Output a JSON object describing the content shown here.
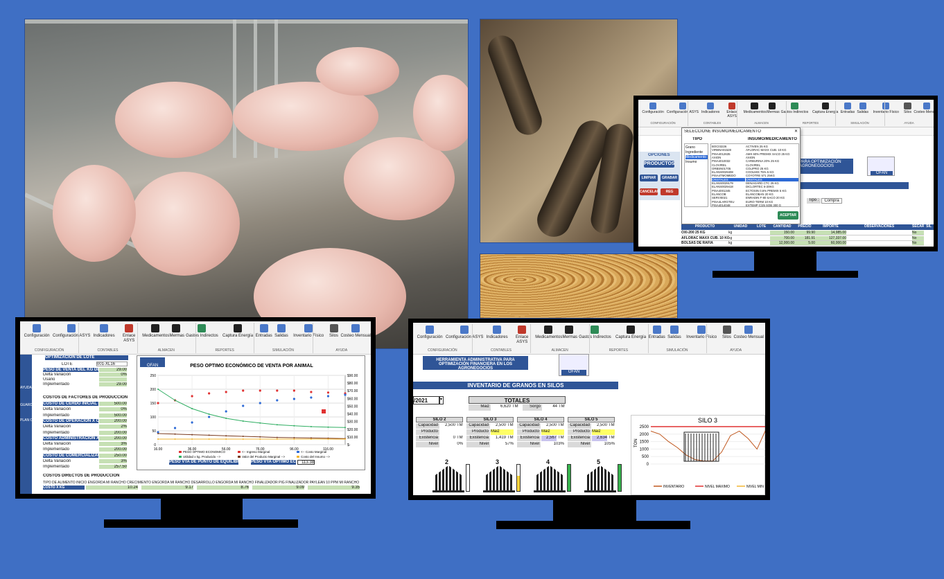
{
  "ribbon": {
    "items": [
      {
        "label": "Configuración",
        "icon": "config-icon",
        "color": "#4a78c8"
      },
      {
        "label": "Configuración ASYS",
        "icon": "config-asys-icon",
        "color": "#4a78c8"
      },
      {
        "label": "Indicadores",
        "icon": "indicadores-icon",
        "color": "#4a78c8"
      },
      {
        "label": "Enlace ASYS",
        "icon": "enlace-icon",
        "color": "#c0392b"
      },
      {
        "label": "Medicamentos",
        "icon": "medicamentos-icon",
        "color": "#222222"
      },
      {
        "label": "Mermas",
        "icon": "mermas-icon",
        "color": "#222222"
      },
      {
        "label": "Gastos Indirectos",
        "icon": "gastos-icon",
        "color": "#2e8b57"
      },
      {
        "label": "Captura Energía",
        "icon": "energia-icon",
        "color": "#222222"
      },
      {
        "label": "Entradas",
        "icon": "entradas-icon",
        "color": "#4a78c8"
      },
      {
        "label": "Salidas",
        "icon": "salidas-icon",
        "color": "#4a78c8"
      },
      {
        "label": "Inventario Físico",
        "icon": "inventario-icon",
        "color": "#4a78c8"
      },
      {
        "label": "Silos",
        "icon": "silos-icon",
        "color": "#555555"
      },
      {
        "label": "Costeo Mensual",
        "icon": "costeo-icon",
        "color": "#4a78c8"
      },
      {
        "label": "Diario",
        "icon": "diario-icon",
        "color": "#4a78c8"
      },
      {
        "label": "Semanal",
        "icon": "semanal-icon",
        "color": "#4a78c8"
      },
      {
        "label": "Mensual",
        "icon": "mensual-icon",
        "color": "#4a78c8"
      },
      {
        "label": "Mermas e Gráficas Inventario",
        "icon": "graficas-icon",
        "color": "#4a78c8"
      },
      {
        "label": "Entrar",
        "icon": "entrar-icon",
        "color": "#4a78c8"
      },
      {
        "label": "Resultados",
        "icon": "resultados-icon",
        "color": "#4a78c8"
      },
      {
        "label": "Acerda de",
        "icon": "acerca-icon",
        "color": "#c0392b"
      },
      {
        "label": "Versión",
        "icon": "version-icon",
        "color": "#4a78c8"
      }
    ],
    "groups": [
      "CONFIGURACIÓN",
      "CONTABLES",
      "ALMACEN",
      "REPORTES",
      "SIMULACIÓN",
      "AYUDA"
    ]
  },
  "monitor_left": {
    "lote_label": "LOTE",
    "lote_value": "001-XL16",
    "opt_title": "OPTIMIZACIÓN DE LOTE",
    "rows": [
      {
        "label": "PESO DE VENTA DEL KG DE CERDO",
        "value": "29.00"
      },
      {
        "label": "Delta Variación",
        "value": "0%"
      },
      {
        "label": "Usario",
        "value": ""
      },
      {
        "label": "Implementado",
        "value": "29.00"
      }
    ],
    "section_costs": "COSTOS DE FACTORES DE PRODUCCIÓN",
    "cost_rows": [
      {
        "label": "COSTO DE CERDO INICIAL ENGORDA",
        "value": "500.00"
      },
      {
        "label": "Delta Variación",
        "value": "0%"
      },
      {
        "label": "Implementado",
        "value": "500.00"
      },
      {
        "label": "COSTO DE OPERACIÓN X CERDO",
        "value": "200.00"
      },
      {
        "label": "Delta Variación",
        "value": "2%"
      },
      {
        "label": "Implementado",
        "value": "200.00"
      },
      {
        "label": "COSTO ADMINISTRACIÓN X CERDO",
        "value": "200.00"
      },
      {
        "label": "Delta Variación",
        "value": "3%"
      },
      {
        "label": "Implementado",
        "value": "200.00"
      },
      {
        "label": "COSTO DE COMERCIALIZACIÓN X CERDO",
        "value": "250.00"
      },
      {
        "label": "Delta Variación",
        "value": "3%"
      },
      {
        "label": "Implementado",
        "value": "257.50"
      }
    ],
    "section_direct": "COSTOS DIRECTOS DE PRODUCCIÓN",
    "feed_header": "TIPO DE ALIMENTO   INICIO ENGORDA MI RANCHO CRECIMIENTO ENGORDA MI RANCHO DESARROLLO ENGORDA MI RANCHO FINALIZADOR PIG FINALIZADOR PAYLEAN 10 PPM MI RANCHO",
    "feed_cost_label": "COSTO X KG",
    "feed_costs": [
      "10.24",
      "9.17",
      "8.76",
      "9.09",
      "9.35"
    ],
    "sidebar_labels": [
      "AYUDA",
      "GUARDAR LOTE",
      "PLAN OPTIMIZACIÓN"
    ],
    "ofan": "OFAN",
    "footer_left_label": "PESO VTA DE PUNTO DE EQUILIBRIO",
    "footer_right_label": "PESO VTA OPTIMO ECONOMICO",
    "footer_right_value": "113.38"
  },
  "chart_data": {
    "type": "scatter",
    "title": "PESO OPTIMO ECONÓMICO DE VENTA POR ANIMAL",
    "x": [
      16,
      26,
      36,
      46,
      56,
      66,
      76,
      86,
      96,
      106,
      116,
      126
    ],
    "xticks": [
      "16.00",
      "36.00",
      "56.00",
      "76.00",
      "96.00",
      "116.00"
    ],
    "ylim": [
      0,
      250
    ],
    "yticks": [
      "0",
      "50",
      "100",
      "150",
      "200",
      "250"
    ],
    "y2ticks": [
      "$-",
      "$10.00",
      "$20.00",
      "$30.00",
      "$40.00",
      "$50.00",
      "$60.00",
      "$70.00",
      "$80.00",
      "$90.00"
    ],
    "series": [
      {
        "name": "<-- Ingreso Marginal",
        "color": "#e03131",
        "values": [
          150,
          160,
          175,
          185,
          190,
          195,
          195,
          195,
          195,
          190,
          188,
          185
        ]
      },
      {
        "name": "<-- Costo Marginal",
        "color": "#2f6bd6",
        "values": [
          45,
          60,
          80,
          100,
          120,
          140,
          150,
          160,
          165,
          170,
          175,
          180
        ]
      },
      {
        "name": "Utilidad x kg. Producido -->",
        "color": "#2fae62",
        "values": [
          200,
          160,
          130,
          110,
          95,
          85,
          78,
          72,
          68,
          65,
          63,
          62
        ]
      },
      {
        "name": "Valor del Producto Marginal -->",
        "color": "#7a3b1f",
        "values": [
          40,
          38,
          36,
          34,
          32,
          30,
          28,
          26,
          25,
          24,
          23,
          22
        ]
      },
      {
        "name": "COSTO X KG PRODUCIDO -->",
        "color": "#f2b632",
        "values": [
          20,
          20,
          20,
          20,
          20,
          20,
          20,
          20,
          20,
          20,
          20,
          20
        ]
      }
    ],
    "legend_items": [
      "PESO OPTIMO ECONOMICO",
      "<-- Ingreso Marginal",
      "<-- Costo Marginal",
      "Utilidad x kg. Producido -->",
      "Valor del Producto Marginal -->",
      "Costo del Insumo -->",
      "COSTO X KG PRODUCIDO -->"
    ]
  },
  "monitor_tr": {
    "dialog_title": "SELECCIONE INSUMO/MEDICAMENTO",
    "tipo_header": "TIPO",
    "insumo_header": "INSUMO/MEDICAMENTO",
    "tipos": [
      "Grano",
      "Ingrediente",
      "Medicamento",
      "Insumo"
    ],
    "insumos": [
      "ACTIVEN 25 KG",
      "AFLORAC MAXX CUB. 10 KG",
      "AMX 60% PREMIX SACO 25 KG",
      "AXION",
      "CARBURINA 20% 25 KG",
      "CLOVIREL",
      "COLIPRO 25 KG",
      "COOLMIX 75% 5 KG",
      "COYOTRE 571 25KG",
      "CRISTALES",
      "DENAGARD CTC 25 KG",
      "DICLORTEC 6-20KG",
      "ECTOSIN 0.6% PREMIX 5 KG",
      "ELANCOBAN 20 KG",
      "ENRADIN F-80 SACO 20 KG",
      "EURO-TERM 10 KG",
      "EXTEMP C/25 SOB 300 G"
    ],
    "codes": [
      "BOC03226",
      "VIRBNA01528",
      "PISA4012635",
      "AXION",
      "PISA4010032",
      "CLOVIREL",
      "ORBSN01705",
      "ELANS0029408",
      "PISA4TMOMEDO",
      "CRISTALES",
      "ELANS0029179",
      "ELANS0029418",
      "PISA4001345",
      "ELANCOB",
      "SERVI0021",
      "PISA4LARGTEU",
      "PISA4014048"
    ],
    "opciones": "OPCIONES",
    "buttons": [
      "PRODUCTOS",
      "LIMPIAR",
      "GRABAR",
      "CANCELAR",
      "REG"
    ],
    "aceptar": "ACEPTAR",
    "banner": "PARA OPTIMIZACIÓN AGRONEGOCIOS",
    "tipo_label": "Tipo :",
    "tipo_value": "Compra",
    "table_headers": [
      "PRODUCTO",
      "UNIDAD",
      "LOTE",
      "CANTIDAD",
      "PRECIO",
      "IMPORTE",
      "OBSERVACIONES",
      "SECAR",
      "SIL"
    ],
    "table_rows": [
      {
        "producto": "OXI-200 25 KG",
        "unidad": "kg",
        "cantidad": "150.00",
        "precio": "99.90",
        "importe": "14,985.00",
        "secar": "No"
      },
      {
        "producto": "AFLORAC MAXX CUB. 10 KG",
        "unidad": "kg",
        "cantidad": "700.00",
        "precio": "181.91",
        "importe": "127,337.00",
        "secar": "No"
      },
      {
        "producto": "BOLSAS DE RAFIA",
        "unidad": "kg",
        "cantidad": "12,000.00",
        "precio": "5.00",
        "importe": "60,000.00",
        "secar": "No"
      }
    ],
    "ofan": "OFAN"
  },
  "monitor_br": {
    "banner": "HERRAMIENTA ADMINISTRATIVA PARA OPTIMIZACIÓN FINANCIERA EN LOS AGRONEGOCIOS",
    "title": "INVENTARIO DE GRANOS EN SILOS",
    "date": "/2021",
    "totales": "TOTALES",
    "maiz_label": "Maiz",
    "maiz_value": "6,620",
    "sorgo_label": "Sorgo",
    "sorgo_value": "44",
    "tm": "TM",
    "silos": [
      {
        "name": "SILO 2",
        "capacidad": "2,500",
        "producto": "",
        "existencia": "0",
        "nivel": "0%",
        "level": 0,
        "color": "#ffd43b"
      },
      {
        "name": "SILO 3",
        "capacidad": "2,500",
        "producto": "Maiz",
        "existencia": "1,419",
        "nivel": "57%",
        "level": 0.57,
        "color": "#ffd43b"
      },
      {
        "name": "SILO 4",
        "capacidad": "2,500",
        "producto": "Maiz",
        "existencia": "2,567",
        "nivel": "103%",
        "level": 1.0,
        "color": "#37b24d"
      },
      {
        "name": "SILO 5",
        "capacidad": "2,500",
        "producto": "Maiz",
        "existencia": "2,634",
        "nivel": "105%",
        "level": 1.0,
        "color": "#37b24d"
      }
    ],
    "silo_numbers": [
      "2",
      "3",
      "4",
      "5"
    ],
    "labels": {
      "capacidad": "Capacidad",
      "producto": "Producto",
      "existencia": "Existencia",
      "nivel": "Nivel"
    },
    "chart_title": "SILO 3",
    "chart_ylabel": "TON",
    "chart_yticks": [
      "0",
      "500",
      "1000",
      "1500",
      "2000",
      "2500"
    ],
    "chart_legend": [
      "INVENTARIO",
      "NIVEL MAXIMO",
      "NIVEL MIN"
    ],
    "ofan": "OFAN"
  }
}
